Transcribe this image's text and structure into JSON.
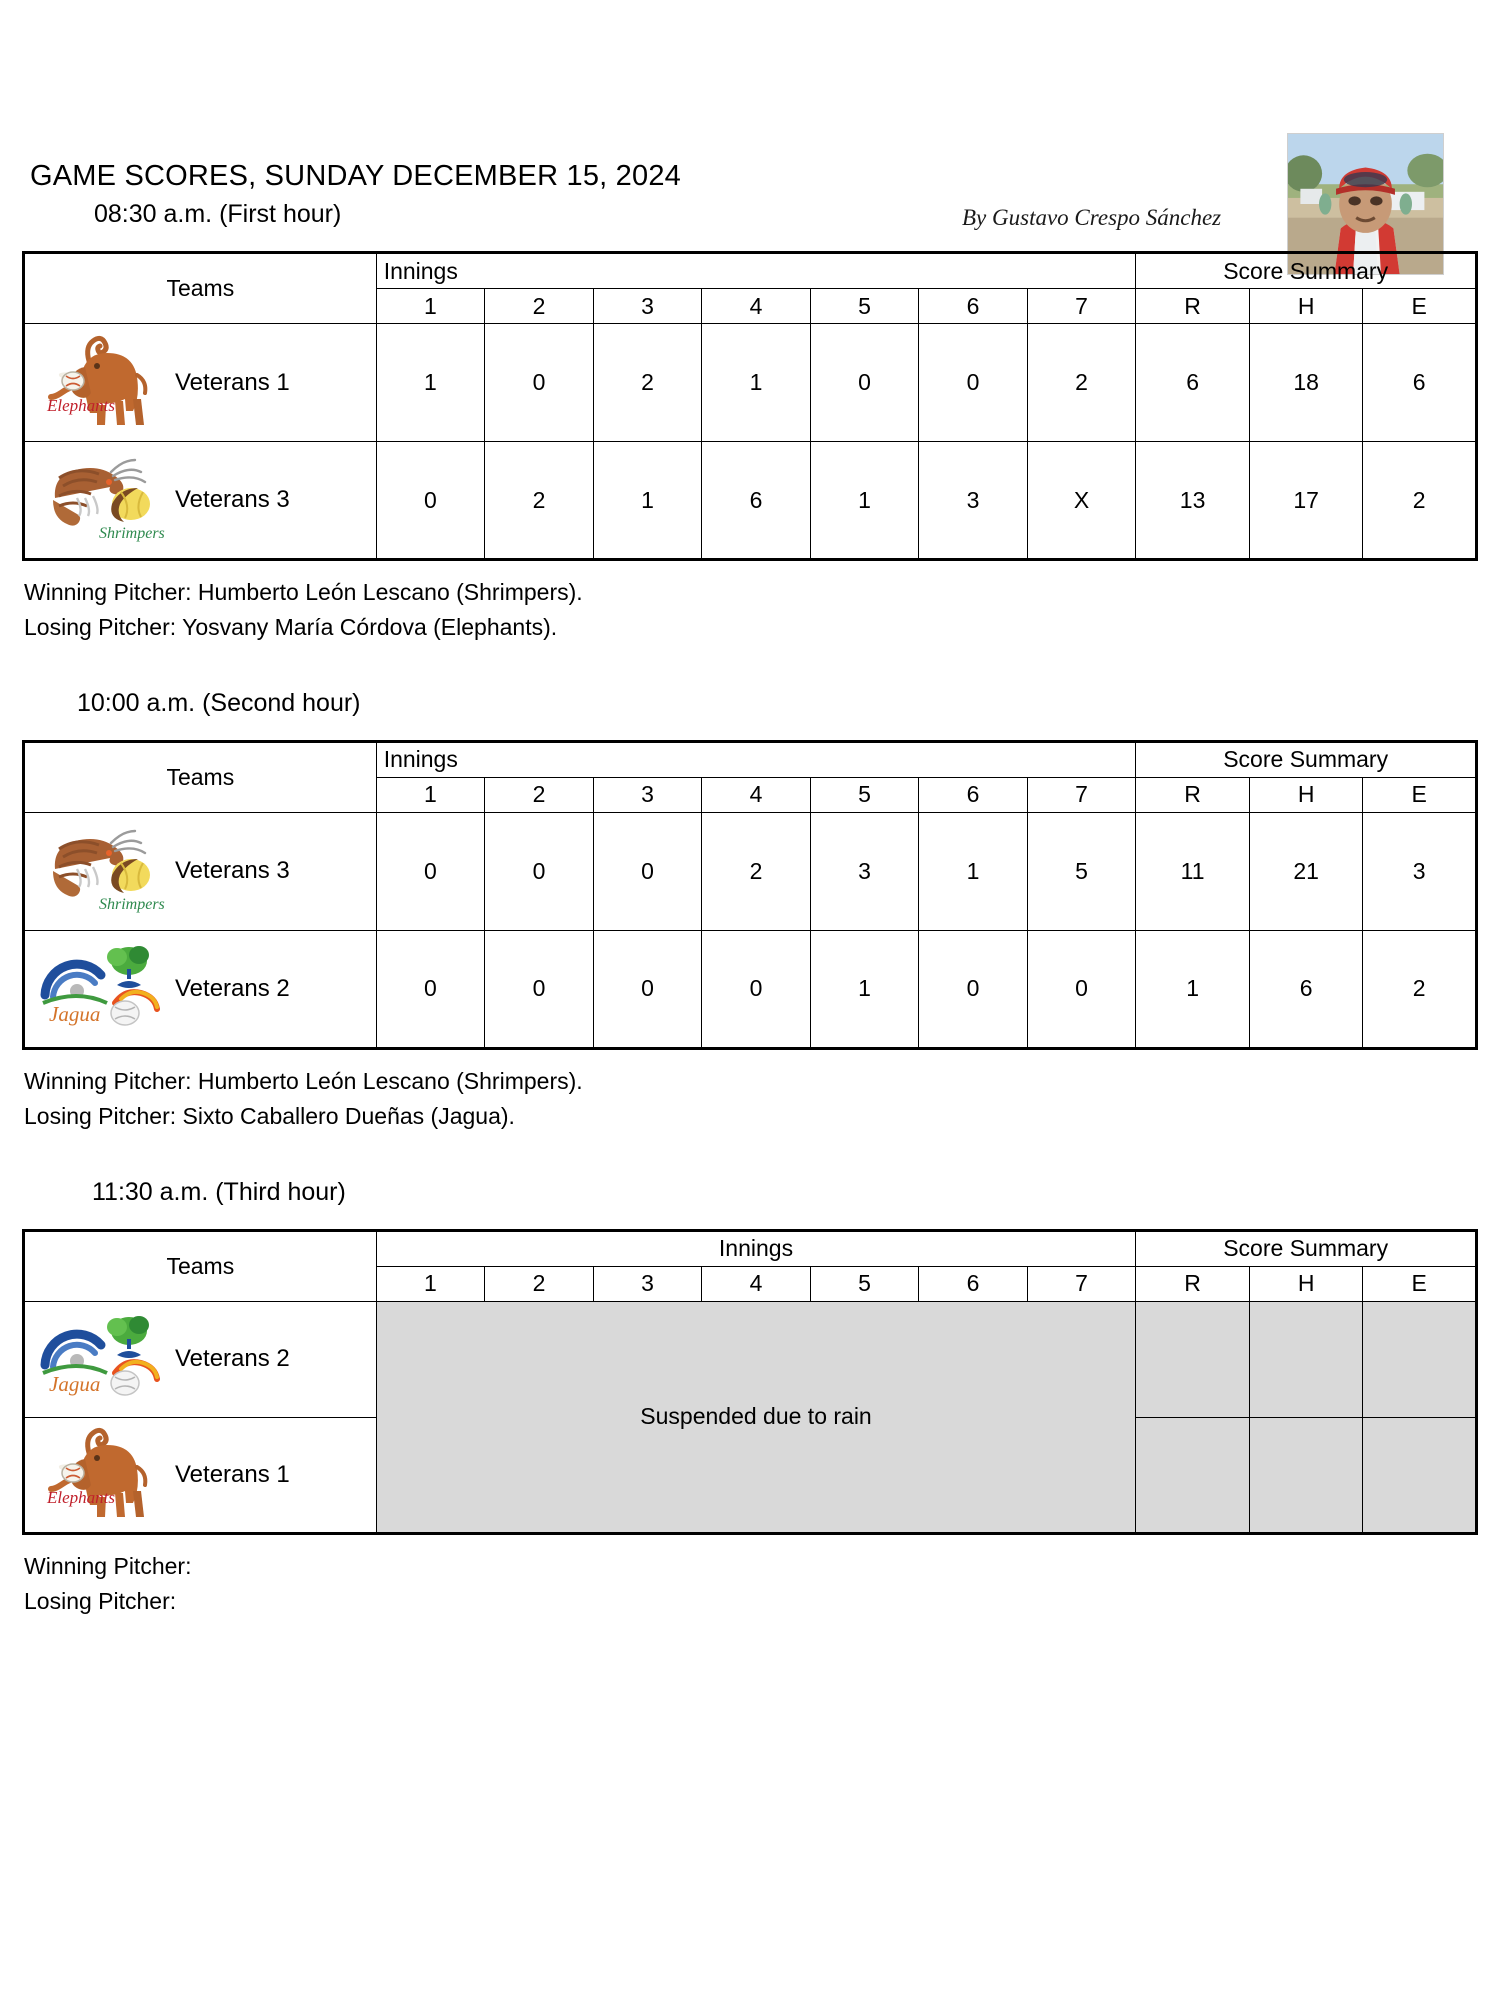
{
  "document": {
    "title": "GAME SCORES, SUNDAY DECEMBER 15, 2024",
    "byline": "By Gustavo Crespo Sánchez",
    "author_photo_alt": "author-portrait"
  },
  "table_headers": {
    "teams": "Teams",
    "innings": "Innings",
    "score_summary": "Score Summary",
    "inning_numbers": [
      "1",
      "2",
      "3",
      "4",
      "5",
      "6",
      "7"
    ],
    "summary_columns": [
      "R",
      "H",
      "E"
    ]
  },
  "labels": {
    "winning_pitcher": "Winning Pitcher:",
    "losing_pitcher": "Losing Pitcher:"
  },
  "games": [
    {
      "time_heading": "08:30 a.m. (First hour)",
      "status": "final",
      "rows": [
        {
          "logo": "elephants-logo",
          "team": "Veterans 1",
          "innings": [
            "1",
            "0",
            "2",
            "1",
            "0",
            "0",
            "2"
          ],
          "r": "6",
          "h": "18",
          "e": "6"
        },
        {
          "logo": "shrimpers-logo",
          "team": "Veterans 3",
          "innings": [
            "0",
            "2",
            "1",
            "6",
            "1",
            "3",
            "X"
          ],
          "r": "13",
          "h": "17",
          "e": "2"
        }
      ],
      "winning_pitcher": "Humberto León Lescano (Shrimpers).",
      "losing_pitcher": "Yosvany María Córdova (Elephants)."
    },
    {
      "time_heading": "10:00 a.m. (Second hour)",
      "status": "final",
      "rows": [
        {
          "logo": "shrimpers-logo",
          "team": "Veterans 3",
          "innings": [
            "0",
            "0",
            "0",
            "2",
            "3",
            "1",
            "5"
          ],
          "r": "11",
          "h": "21",
          "e": "3"
        },
        {
          "logo": "jagua-logo",
          "team": "Veterans 2",
          "innings": [
            "0",
            "0",
            "0",
            "0",
            "1",
            "0",
            "0"
          ],
          "r": "1",
          "h": "6",
          "e": "2"
        }
      ],
      "winning_pitcher": "Humberto León Lescano (Shrimpers).",
      "losing_pitcher": "Sixto Caballero Dueñas (Jagua)."
    },
    {
      "time_heading": "11:30 a.m. (Third hour)",
      "status": "suspended",
      "suspended_message": "Suspended due to rain",
      "rows": [
        {
          "logo": "jagua-logo",
          "team": "Veterans 2"
        },
        {
          "logo": "elephants-logo",
          "team": "Veterans 1"
        }
      ],
      "winning_pitcher": "",
      "losing_pitcher": ""
    }
  ],
  "colors": {
    "grid": "#000000",
    "suspended_fill": "#d9d9d9",
    "elephant": "#c0692f",
    "shrimp": "#9a5a2a",
    "jagua_blue": "#1f4e9c",
    "jagua_green": "#3f9a3f",
    "jagua_orange": "#d4742a"
  }
}
